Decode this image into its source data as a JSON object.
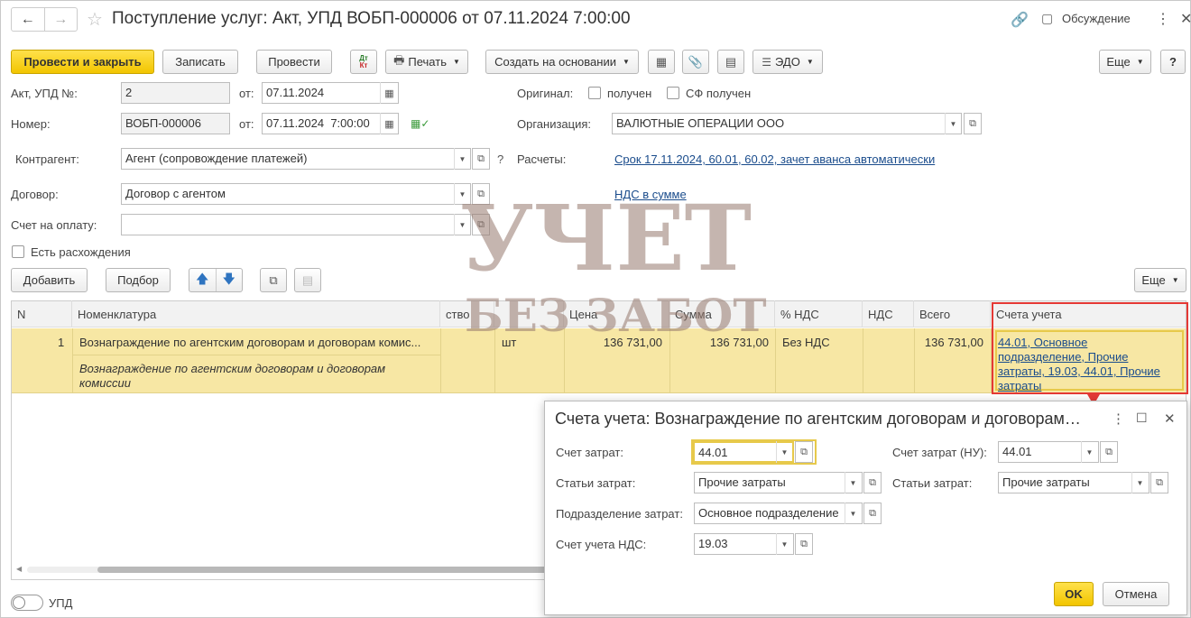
{
  "window": {
    "title": "Поступление услуг: Акт, УПД ВОБП-000006 от 07.11.2024 7:00:00",
    "discussion": "Обсуждение"
  },
  "toolbar": {
    "post_close": "Провести и закрыть",
    "save": "Записать",
    "post": "Провести",
    "dtkt": "Дт Кт",
    "print": "Печать",
    "create_based": "Создать на основании",
    "edo": "ЭДО",
    "more": "Еще",
    "help": "?"
  },
  "form": {
    "act_label": "Акт, УПД №:",
    "act_value": "2",
    "from_label": "от:",
    "act_date": "07.11.2024",
    "number_label": "Номер:",
    "number_value": "ВОБП-000006",
    "number_date": "07.11.2024  7:00:00",
    "original_label": "Оригинал:",
    "received": "получен",
    "sf_received": "СФ получен",
    "org_label": "Организация:",
    "org_value": "ВАЛЮТНЫЕ ОПЕРАЦИИ ООО",
    "contractor_label": "Контрагент:",
    "contractor_value": "Агент (сопровождение платежей)",
    "help_q": "?",
    "settlements_label": "Расчеты:",
    "settlements_link": "Срок 17.11.2024, 60.01, 60.02, зачет аванса автоматически",
    "contract_label": "Договор:",
    "contract_value": "Договор с агентом",
    "vat_link": "НДС в сумме",
    "invoice_label": "Счет на оплату:",
    "invoice_value": "",
    "discrepancy": "Есть расхождения"
  },
  "table_toolbar": {
    "add": "Добавить",
    "pick": "Подбор",
    "more": "Еще"
  },
  "table": {
    "headers": [
      "N",
      "Номенклатура",
      "ство",
      "",
      "Цена",
      "Сумма",
      "% НДС",
      "НДС",
      "Всего",
      "Счета учета"
    ],
    "row": {
      "n": "1",
      "name": "Вознаграждение по агентским договорам и договорам комис...",
      "desc_line1": "Вознаграждение по агентским договорам и договорам",
      "desc_line2": "комиссии",
      "unit": "шт",
      "price": "136 731,00",
      "sum": "136 731,00",
      "vat_rate": "Без НДС",
      "vat": "",
      "total": "136 731,00",
      "accounts_line1": "44.01, Основное",
      "accounts_line2": "подразделение, Прочие",
      "accounts_line3": "затраты, 19.03, 44.01, Прочие",
      "accounts_line4": "затраты"
    }
  },
  "footer": {
    "upd_label": "УПД"
  },
  "dialog": {
    "title": "Счета учета: Вознаграждение по агентским договорам и договорам…",
    "cost_account_label": "Счет затрат:",
    "cost_account_value": "44.01",
    "cost_items_label": "Статьи затрат:",
    "cost_items_value": "Прочие затраты",
    "cost_dept_label": "Подразделение затрат:",
    "cost_dept_value": "Основное подразделение",
    "vat_account_label": "Счет учета НДС:",
    "vat_account_value": "19.03",
    "cost_account_nu_label": "Счет затрат (НУ):",
    "cost_account_nu_value": "44.01",
    "cost_items_nu_label": "Статьи затрат:",
    "cost_items_nu_value": "Прочие затраты",
    "ok": "OK",
    "cancel": "Отмена"
  },
  "watermark": {
    "line1": "УЧЕТ",
    "line2": "БЕЗ ЗАБОТ"
  },
  "colors": {
    "primary_button": "#f2c500",
    "selected_row": "#f7e7a4",
    "highlight_border": "#e53935",
    "link": "#1a4c8c"
  }
}
